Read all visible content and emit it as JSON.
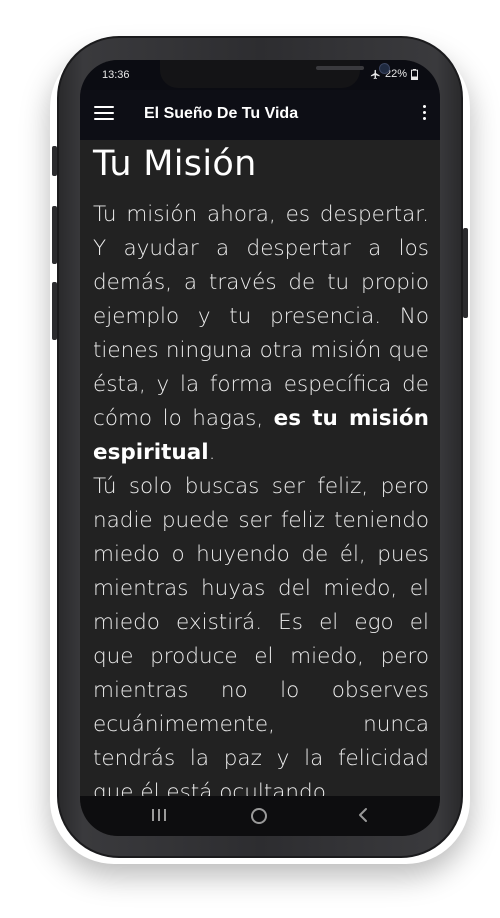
{
  "status_bar": {
    "time": "13:36",
    "battery": "22%",
    "icons": [
      "airplane-icon",
      "battery-icon"
    ]
  },
  "app_bar": {
    "title": "El Sueño De Tu Vida",
    "icons": [
      "menu-icon",
      "more-vert-icon"
    ]
  },
  "content": {
    "title": "Tu Misión",
    "paragraph1_text": "Tu misión ahora, es despertar. Y ayudar a despertar a los demás, a través de tu propio ejemplo y tu presencia. No tienes ninguna otra misión que ésta, y la forma específica de cómo lo hagas, ",
    "paragraph1_bold": "es tu misión espiritual",
    "paragraph1_end": ".",
    "paragraph2_text": "Tú solo buscas ser feliz, pero nadie puede ser feliz teniendo miedo o huyendo de él, pues mientras huyas del miedo, el miedo existirá. Es el ego el que produce el miedo, pero mientras no lo observes ecuánimemente, nunca tendrás la paz y la felicidad que él está ocultando."
  },
  "nav_bar": {
    "icons": [
      "recent-apps-icon",
      "home-icon",
      "back-icon"
    ]
  },
  "colors": {
    "screen_background": "#222222",
    "app_bar_background": "#0d0e15",
    "text": "#ececec"
  }
}
